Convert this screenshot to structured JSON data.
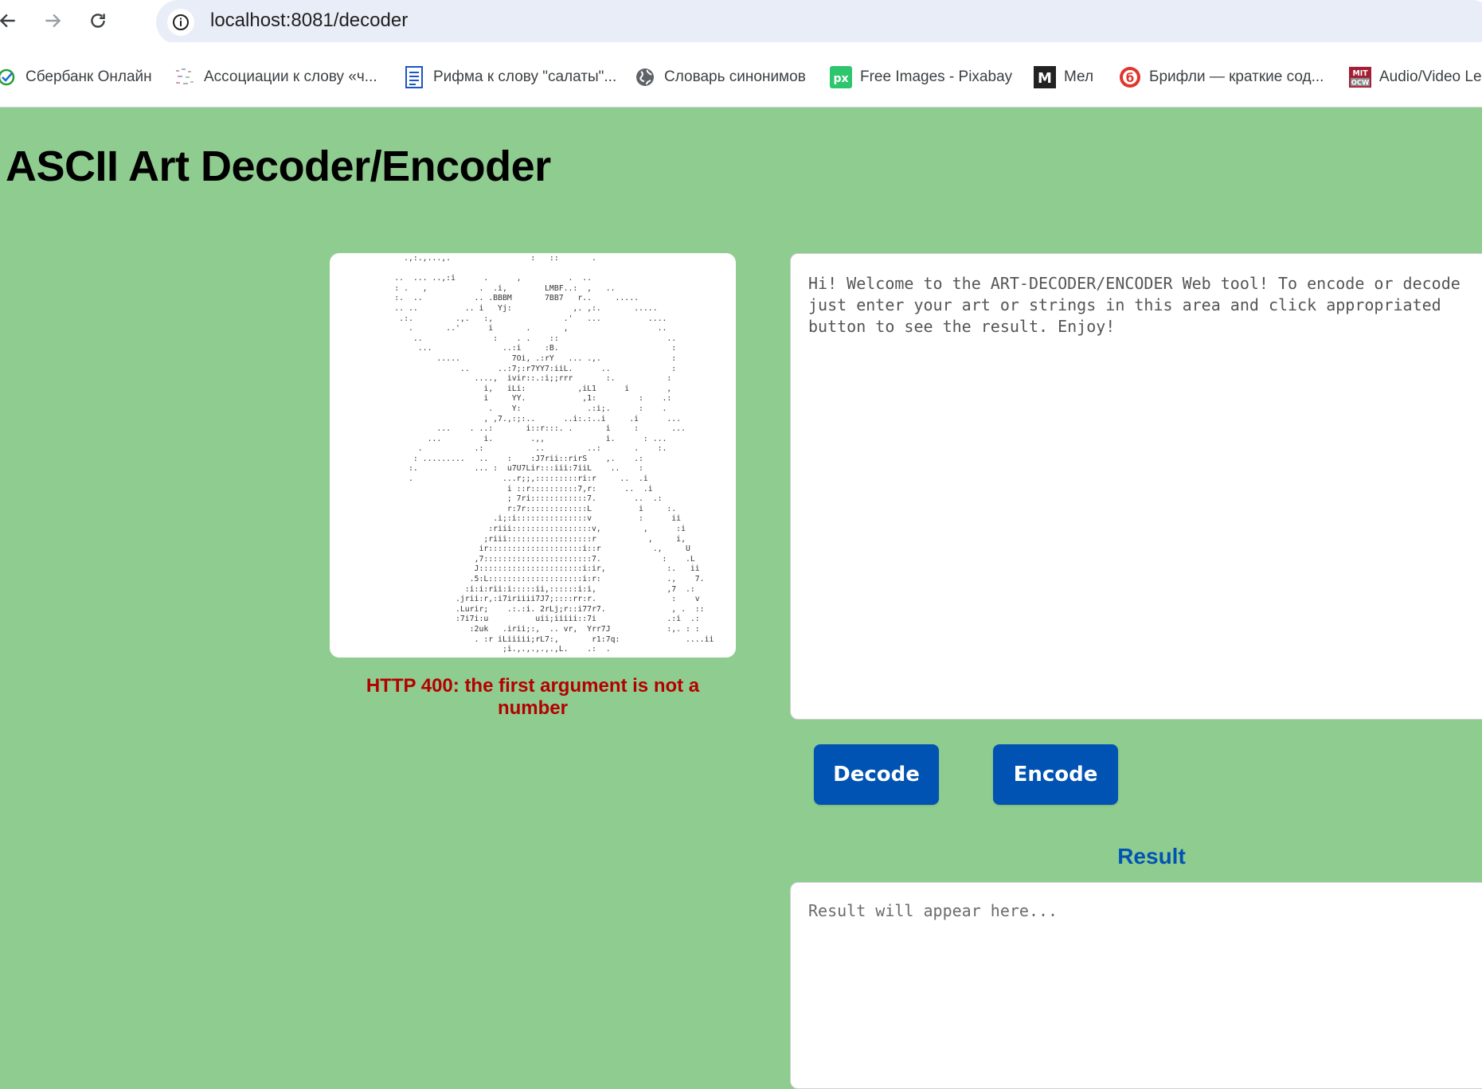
{
  "browser": {
    "url": "localhost:8081/decoder",
    "bookmarks": [
      {
        "label": "Сбербанк Онлайн",
        "icon": "sberbank-icon"
      },
      {
        "label": "Ассоциации к слову «ч...",
        "icon": "associations-icon"
      },
      {
        "label": "Рифма к слову \"салаты\"...",
        "icon": "document-icon"
      },
      {
        "label": "Словарь синонимов",
        "icon": "globe-icon"
      },
      {
        "label": "Free Images - Pixabay",
        "icon": "pixabay-icon"
      },
      {
        "label": "Мел",
        "icon": "mel-icon"
      },
      {
        "label": "Брифли — краткие сод...",
        "icon": "briefly-icon"
      },
      {
        "label": "Audio/Video Le",
        "icon": "mit-ocw-icon"
      }
    ]
  },
  "page": {
    "title": "ASCII Art Decoder/Encoder",
    "error": "HTTP 400: the first argument is not a number",
    "input_text": "Hi! Welcome to the ART-DECODER/ENCODER Web tool! To encode or decode\njust enter your art or strings in this area and click appropriated\nbutton to see the result. Enjoy!",
    "decode_label": "Decode",
    "encode_label": "Encode",
    "result_label": "Result",
    "result_placeholder": "Result will appear here...",
    "art": "         .,:.,...,.                 :   ::       .\n\n       ..  ... ..,:i      .      ,          .  ..\n       : .   ,           .  .i,        LMBF..:  ,   ..\n       :.  ..           .. .BBBM       7BB7   r..     .....\n       .. ..          .. i   Yj:             ,. ,:.       .....\n        .:.         .,.   :,               .'   ...          ....\n          .       ..'      i       .       ,                   ..\n           ..               :    . .    ::                       ..\n            ...               ..:i     :B.                        :\n                .....           7Oi, .:rY   ... .,.               :\n                     ..      ..:7;:r7YY7:iiL.      ..             :\n                        ....,  ivir::.:i;;rrr       :.           :\n                          i,   iLi:           ,iL1      i        ,\n                          i     YY.            ,1:         :    .:\n                           .    Y:              .:i;.      :    .\n                          , ,7.,:;:..      ..i:.:..i     .i      ...\n                ...    . ..:       i::r:::. .       i     :       ...\n              ...         i.        .,,             i.      : ...\n            .           .:           ..         ..:       .    :.\n           : .........   ..    :    :J7rii::rirS    ,.    .:\n          :.            ... :  u7U7Lir:::iii:7iiL    ..    :\n          .                   ...r;;,:::::::::ri:r     ..  .i\n                               i ::r::::::::::7,r:      ..  .i\n                               ; 7ri::::::::::::7.        ..  .:\n                               r:7r:::::::::::::L          i     :.\n                            .i;:i:::::::::::::::v          :      ii\n                           :riii:::::::::::::::::v,         ,      :i\n                          ;riii::::::::::::::::::r           ,     i,\n                         ir::::::::::::::::::::i::r           .,     U\n                        ,7:::::::::::::::::::::::7.             :    .L\n                        J::::::::::::::::::::::i:ir,             :.   ii\n                       .5:L::::::::::::::::::::i:r:              .,    7.\n                      :i:i:rii:i:::::ii,::::::i:i,               ,7  .:\n                    .jrii:r,:i7iriiii7J7;::::rr:r.                :    v\n                    .Lurir;    .:.:i. 2rLj;r::i77r7.              , .  ::\n                    :7i7i:u          uii;iiiii::7i               .:i  .:\n                       :2uk   .irii;:,  .. vr,  Yrr7J            :,. : :\n                        . :r iLiiiii;rL7:,       r1:7q:              ....ii\n                              ;i.,.,.,.,.,L.    .:  ."
  }
}
